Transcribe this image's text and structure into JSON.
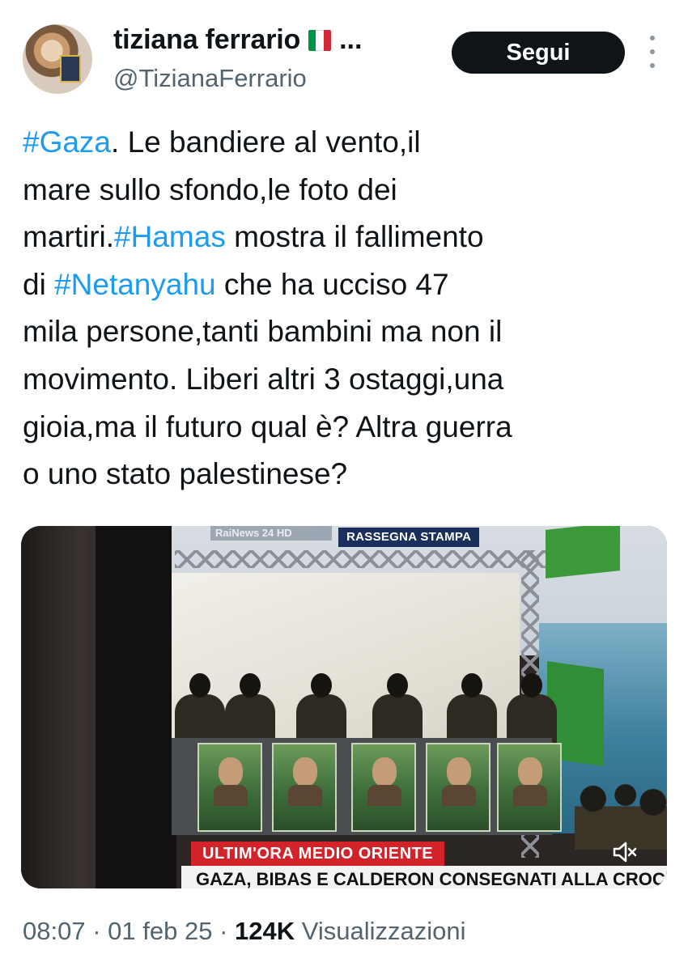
{
  "author": {
    "name": "tiziana ferrario",
    "truncation": "...",
    "handle": "@TizianaFerrario",
    "flag_icon": "italy-flag-icon",
    "flag_colors": [
      "#009246",
      "#ffffff",
      "#ce2b37"
    ]
  },
  "follow_button_label": "Segui",
  "tweet": {
    "lines": [
      [
        {
          "text": "#Gaza",
          "hashtag": true
        },
        {
          "text": ". Le bandiere al vento,il"
        }
      ],
      [
        {
          "text": "mare sullo sfondo,le foto dei"
        }
      ],
      [
        {
          "text": "martiri."
        },
        {
          "text": "#Hamas",
          "hashtag": true
        },
        {
          "text": " mostra il fallimento"
        }
      ],
      [
        {
          "text": "di "
        },
        {
          "text": "#Netanyahu",
          "hashtag": true
        },
        {
          "text": " che ha ucciso 47"
        }
      ],
      [
        {
          "text": "mila persone,tanti bambini ma non il"
        }
      ],
      [
        {
          "text": "movimento. Liberi altri  3 ostaggi,una"
        }
      ],
      [
        {
          "text": "gioia,ma il futuro qual è? Altra guerra"
        }
      ],
      [
        {
          "text": "o uno stato palestinese?"
        }
      ]
    ]
  },
  "media": {
    "tv_logo": "RaiNews 24 HD",
    "overlay_label": "RASSEGNA STAMPA",
    "breaking_label": "ULTIM'ORA MEDIO ORIENTE",
    "ticker_text": "GAZA, BIBAS E CALDERON CONSEGNATI ALLA CROCE",
    "mute_icon": "speaker-muted-icon"
  },
  "meta": {
    "time": "08:07",
    "separator": "·",
    "date": "01 feb 25",
    "views_count": "124K",
    "views_label": "Visualizzazioni"
  },
  "colors": {
    "hashtag": "#1d9bf0",
    "follow_bg": "#0f1419",
    "meta_text": "#536471"
  }
}
